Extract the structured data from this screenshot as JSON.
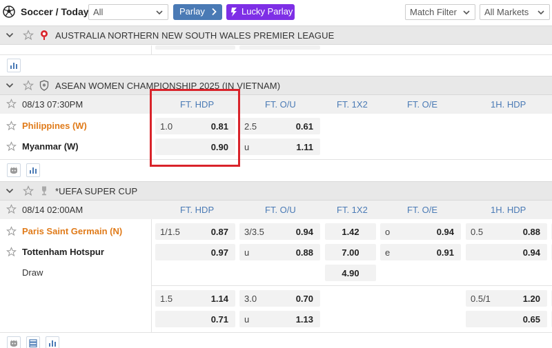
{
  "topbar": {
    "breadcrumb": "Soccer / Today",
    "select_value": "All",
    "parlay_label": "Parlay",
    "lucky_parlay_label": "Lucky Parlay",
    "match_filter_label": "Match Filter",
    "markets_label": "All Markets"
  },
  "colors": {
    "accent": "#4a7ab5",
    "lucky": "#7e2fe6",
    "favorite": "#e07b1a",
    "highlight": "#d9232a"
  },
  "leagues": [
    {
      "name": "AUSTRALIA NORTHERN NEW SOUTH WALES PREMIER LEAGUE"
    },
    {
      "name": "ASEAN WOMEN CHAMPIONSHIP 2025 (IN VIETNAM)"
    },
    {
      "name": "*UEFA SUPER CUP"
    }
  ],
  "columns": [
    "FT. HDP",
    "FT. O/U",
    "FT. 1X2",
    "FT. O/E",
    "1H. HDP"
  ],
  "matches": [
    {
      "time": "08/13 07:30PM",
      "home": "Philippines (W)",
      "away": "Myanmar (W)",
      "hdp": {
        "line": "1.0",
        "home": "0.81",
        "away": "0.90"
      },
      "ou": {
        "line": "2.5",
        "over": "0.61",
        "under_label": "u",
        "under": "1.11"
      }
    },
    {
      "time": "08/14 02:00AM",
      "home": "Paris Saint Germain (N)",
      "away": "Tottenham Hotspur",
      "draw_label": "Draw",
      "hdp": {
        "line": "1/1.5",
        "home": "0.87",
        "away": "0.97"
      },
      "ou": {
        "line": "3/3.5",
        "over": "0.94",
        "under_label": "u",
        "under": "0.88"
      },
      "x12": {
        "home": "1.42",
        "away": "7.00",
        "draw": "4.90"
      },
      "oe": {
        "odd_label": "o",
        "odd": "0.94",
        "even_label": "e",
        "even": "0.91"
      },
      "h1hdp": {
        "line": "0.5",
        "home": "0.88",
        "away": "0.94"
      },
      "alt": {
        "hdp": {
          "line": "1.5",
          "home": "1.14",
          "away": "0.71"
        },
        "ou": {
          "line": "3.0",
          "over": "0.70",
          "under_label": "u",
          "under": "1.13"
        },
        "h1hdp": {
          "line": "0.5/1",
          "home": "1.20",
          "away": "0.65"
        }
      }
    }
  ],
  "icons": [
    "soccer-ball-icon",
    "chevron-down-icon",
    "chevron-right-icon",
    "lightning-icon",
    "star-icon",
    "flag-icon",
    "stats-icon",
    "live-icon",
    "list-icon"
  ]
}
